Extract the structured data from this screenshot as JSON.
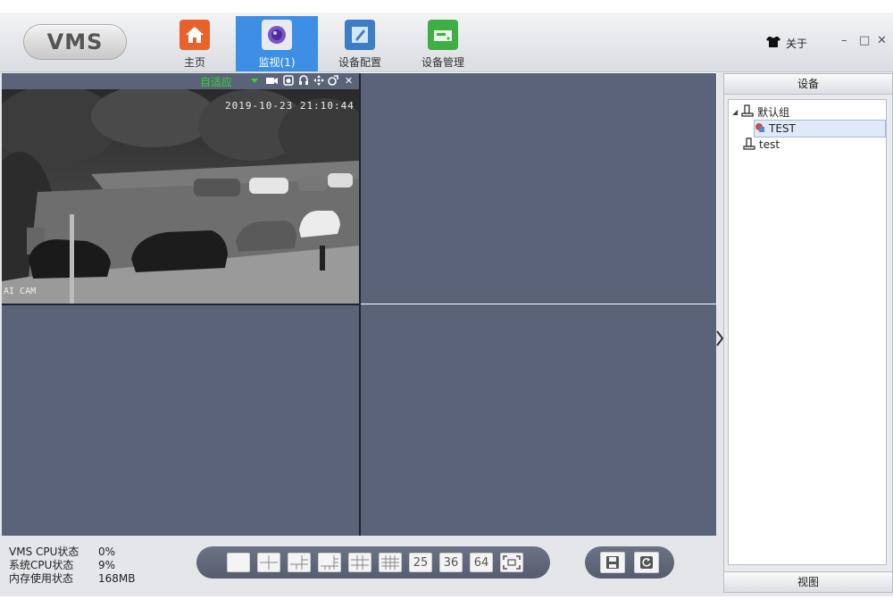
{
  "app": {
    "logo": "VMS",
    "nav": [
      {
        "label": "主页",
        "icon": "home-icon"
      },
      {
        "label": "监视(1)",
        "icon": "monitor-lens-icon"
      },
      {
        "label": "设备配置",
        "icon": "device-config-icon"
      },
      {
        "label": "设备管理",
        "icon": "device-manage-icon"
      }
    ],
    "active_nav": 1,
    "about_label": "关于"
  },
  "video": {
    "fit_mode": "自适应",
    "timestamp": "2019-10-23 21:10:44",
    "camera_overlay": "AI CAM"
  },
  "panel": {
    "header": "设备",
    "footer": "视图",
    "tree": {
      "group": "默认组",
      "device": "TEST",
      "group2": "test"
    }
  },
  "status": {
    "vms_cpu_label": "VMS CPU状态",
    "vms_cpu_value": "0%",
    "sys_cpu_label": "系统CPU状态",
    "sys_cpu_value": "9%",
    "mem_label": "内存使用状态",
    "mem_value": "168MB"
  },
  "layouts": {
    "n25": "25",
    "n36": "36",
    "n64": "64"
  },
  "colors": {
    "accent": "#3d8fe6",
    "video_bg": "#5a6378",
    "fit_green": "#35d435"
  }
}
